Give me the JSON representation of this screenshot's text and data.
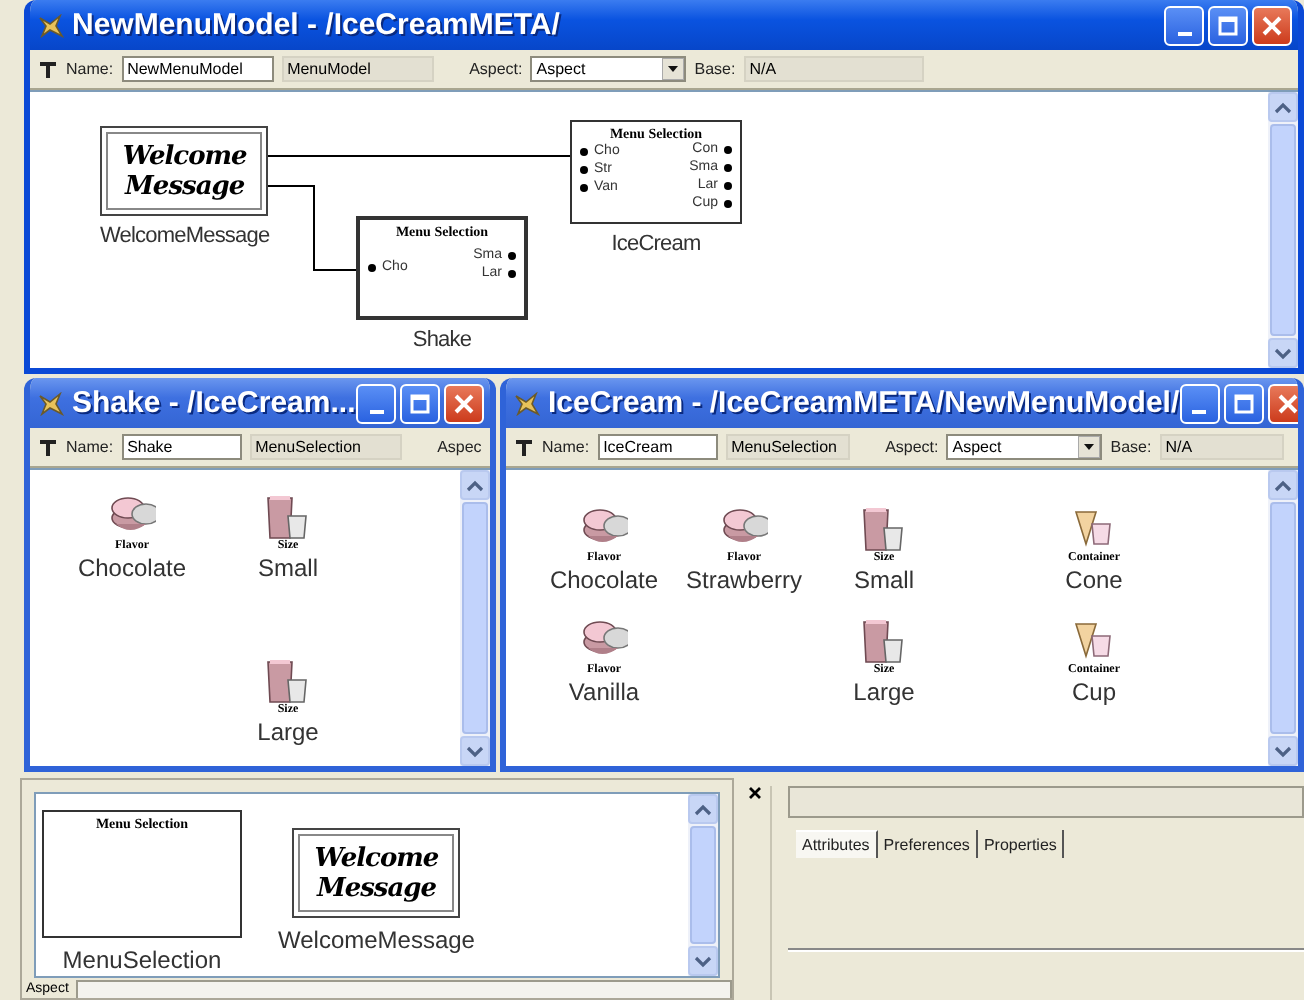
{
  "model_window": {
    "title": "NewMenuModel - /IceCreamMETA/",
    "toolbar": {
      "name_label": "Name:",
      "name": "NewMenuModel",
      "type": "MenuModel",
      "aspect_label": "Aspect:",
      "aspect": "Aspect",
      "base_label": "Base:",
      "base": "N/A"
    },
    "nodes": [
      {
        "kind": "welcome",
        "text": "Welcome Message",
        "label": "WelcomeMessage"
      },
      {
        "kind": "selection",
        "header": "Menu Selection",
        "inputs": [
          "Cho",
          "Str",
          "Van"
        ],
        "outputs": [
          "Con",
          "Sma",
          "Lar",
          "Cup"
        ],
        "label": "IceCream"
      },
      {
        "kind": "selection",
        "header": "Menu Selection",
        "inputs": [
          "Cho"
        ],
        "outputs": [
          "Sma",
          "Lar"
        ],
        "label": "Shake"
      }
    ]
  },
  "shake_window": {
    "title": "Shake - /IceCream...",
    "toolbar": {
      "name_label": "Name:",
      "name": "Shake",
      "type": "MenuSelection",
      "aspect_label": "Aspec"
    },
    "parts": [
      {
        "kind": "flavor",
        "category": "Flavor",
        "label": "Chocolate"
      },
      {
        "kind": "size",
        "category": "Size",
        "label": "Small"
      },
      {
        "kind": "size",
        "category": "Size",
        "label": "Large"
      }
    ]
  },
  "icecream_window": {
    "title": "IceCream - /IceCreamMETA/NewMenuModel/",
    "toolbar": {
      "name_label": "Name:",
      "name": "IceCream",
      "type": "MenuSelection",
      "aspect_label": "Aspect:",
      "aspect": "Aspect",
      "base_label": "Base:",
      "base": "N/A"
    },
    "parts": [
      {
        "kind": "flavor",
        "category": "Flavor",
        "label": "Chocolate"
      },
      {
        "kind": "flavor",
        "category": "Flavor",
        "label": "Strawberry"
      },
      {
        "kind": "size",
        "category": "Size",
        "label": "Small"
      },
      {
        "kind": "container",
        "category": "Container",
        "label": "Cone"
      },
      {
        "kind": "flavor",
        "category": "Flavor",
        "label": "Vanilla"
      },
      {
        "kind": "size",
        "category": "Size",
        "label": "Large"
      },
      {
        "kind": "container",
        "category": "Container",
        "label": "Cup"
      }
    ]
  },
  "parts_browser": {
    "items": [
      {
        "kind": "selection",
        "header": "Menu Selection",
        "label": "MenuSelection"
      },
      {
        "kind": "welcome",
        "text": "Welcome Message",
        "label": "WelcomeMessage"
      }
    ],
    "aspect_label": "Aspect"
  },
  "inspector": {
    "tabs": [
      {
        "label": "Attributes",
        "selected": true
      },
      {
        "label": "Preferences",
        "selected": false
      },
      {
        "label": "Properties",
        "selected": false
      }
    ]
  }
}
